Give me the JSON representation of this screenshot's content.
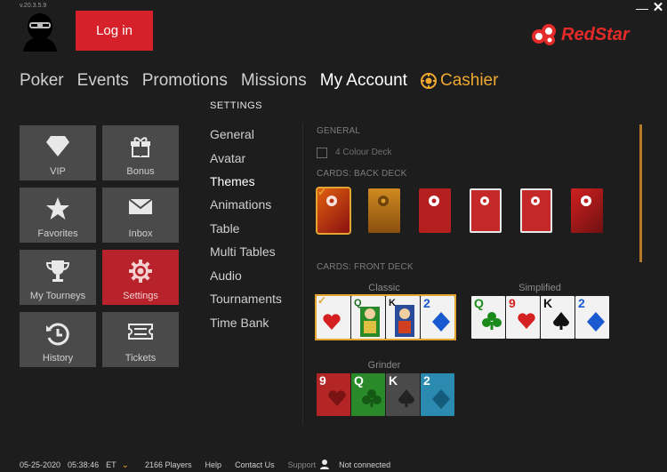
{
  "app": {
    "version": "v.20.3.5.9",
    "login_label": "Log in",
    "brand_name": "RedStar",
    "accent_color": "#d6202a",
    "highlight_color": "#e3a530"
  },
  "nav": {
    "items": [
      "Poker",
      "Events",
      "Promotions",
      "Missions",
      "My Account"
    ],
    "cashier": "Cashier"
  },
  "tiles": [
    {
      "label": "VIP",
      "icon": "diamond-icon"
    },
    {
      "label": "Bonus",
      "icon": "gift-icon"
    },
    {
      "label": "Favorites",
      "icon": "star-icon"
    },
    {
      "label": "Inbox",
      "icon": "envelope-icon"
    },
    {
      "label": "My Tourneys",
      "icon": "trophy-icon"
    },
    {
      "label": "Settings",
      "icon": "gear-icon",
      "active": true
    },
    {
      "label": "History",
      "icon": "history-icon"
    },
    {
      "label": "Tickets",
      "icon": "ticket-icon"
    }
  ],
  "settings": {
    "title": "SETTINGS",
    "menu": [
      "General",
      "Avatar",
      "Themes",
      "Animations",
      "Table",
      "Multi Tables",
      "Audio",
      "Tournaments",
      "Time Bank"
    ],
    "active": "Themes"
  },
  "themes": {
    "general_label": "GENERAL",
    "four_colour_label": "4 Colour Deck",
    "four_colour_checked": false,
    "back_deck_label": "CARDS: BACK DECK",
    "front_deck_label": "CARDS: FRONT DECK",
    "front_decks": [
      {
        "name": "Classic",
        "selected": true
      },
      {
        "name": "Simplified",
        "selected": false
      },
      {
        "name": "Grinder",
        "selected": false
      }
    ],
    "card_ranks": [
      "9",
      "Q",
      "K",
      "2"
    ]
  },
  "footer": {
    "date": "05-25-2020",
    "time": "05:38:46",
    "timezone": "ET",
    "players": "2166 Players",
    "help": "Help",
    "contact": "Contact Us",
    "support": "Support",
    "status": "Not connected"
  }
}
